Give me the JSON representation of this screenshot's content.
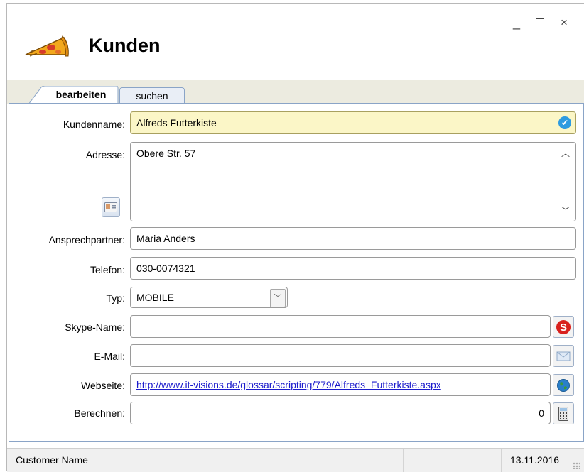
{
  "window": {
    "title": "Kunden",
    "minimize": "_",
    "close": "×"
  },
  "tabs": [
    {
      "label": "bearbeiten",
      "active": true
    },
    {
      "label": "suchen",
      "active": false
    }
  ],
  "form": {
    "kundenname": {
      "label": "Kundenname:",
      "value": "Alfreds Futterkiste"
    },
    "adresse": {
      "label": "Adresse:",
      "value": "Obere Str. 57"
    },
    "ansprechpartner": {
      "label": "Ansprechpartner:",
      "value": "Maria Anders"
    },
    "telefon": {
      "label": "Telefon:",
      "value": "030-0074321"
    },
    "typ": {
      "label": "Typ:",
      "value": "MOBILE"
    },
    "skype": {
      "label": "Skype-Name:",
      "value": ""
    },
    "email": {
      "label": "E-Mail:",
      "value": ""
    },
    "webseite": {
      "label": "Webseite:",
      "value": "http://www.it-visions.de/glossar/scripting/779/Alfreds_Futterkiste.aspx"
    },
    "berechnen": {
      "label": "Berechnen:",
      "value": "0"
    }
  },
  "icons": {
    "check": "check-icon",
    "contact_card": "contact-card-icon",
    "skype": "skype-icon",
    "email": "envelope-icon",
    "web": "globe-icon",
    "calculator": "calculator-icon"
  },
  "status": {
    "text": "Customer Name",
    "date": "13.11.2016"
  },
  "colors": {
    "accent": "#2e9be0",
    "highlight_field": "#fbf6c7",
    "tab_border": "#8aa4c7",
    "link": "#1c1ccc",
    "skype_red": "#d8211d"
  }
}
